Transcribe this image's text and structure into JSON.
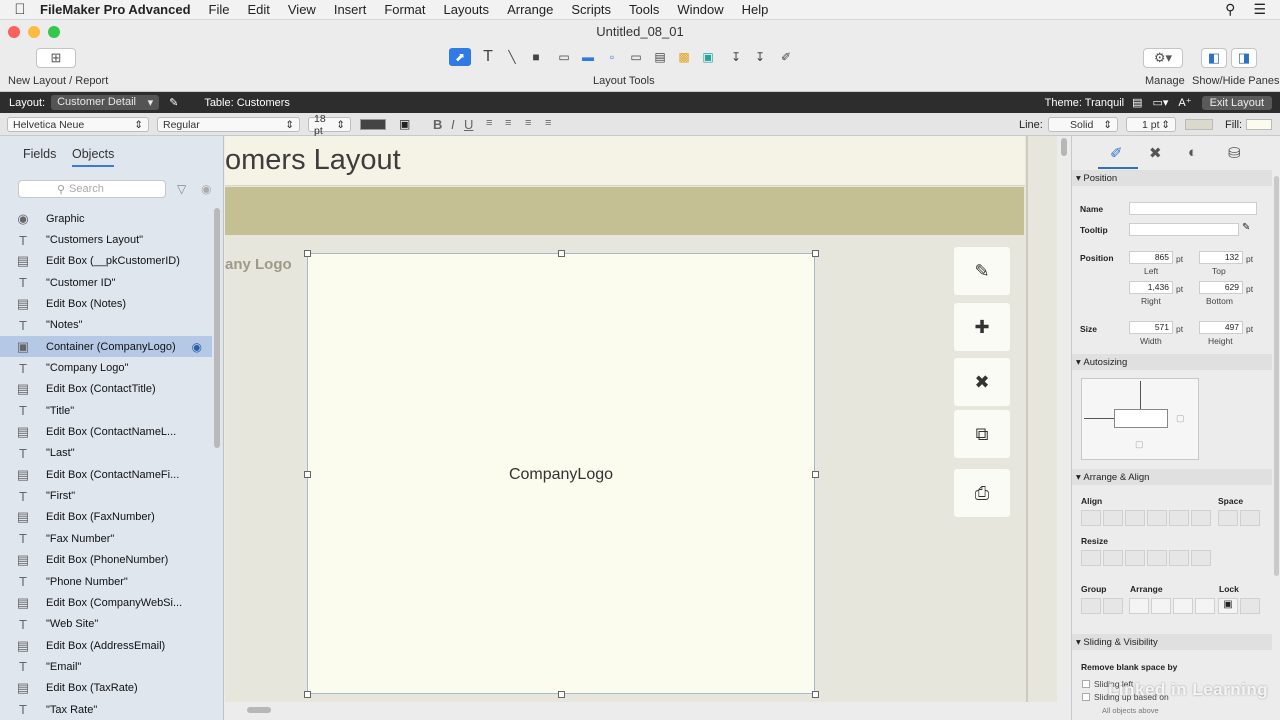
{
  "menubar": {
    "app_name": "FileMaker Pro Advanced",
    "menus": [
      "File",
      "Edit",
      "View",
      "Insert",
      "Format",
      "Layouts",
      "Arrange",
      "Scripts",
      "Tools",
      "Window",
      "Help"
    ]
  },
  "window": {
    "title": "Untitled_08_01"
  },
  "toolbar": {
    "new_layout_label": "New Layout / Report",
    "layout_tools_label": "Layout Tools",
    "manage_label": "Manage",
    "show_hide_label": "Show/Hide Panes"
  },
  "layoutbar": {
    "layout_label": "Layout:",
    "layout_value": "Customer Detail",
    "table_label": "Table: Customers",
    "theme_label": "Theme: Tranquil",
    "exit_label": "Exit Layout"
  },
  "formatbar": {
    "font": "Helvetica Neue",
    "style": "Regular",
    "size": "18 pt",
    "line_label": "Line:",
    "line_style": "Solid",
    "line_width": "1 pt",
    "fill_label": "Fill:"
  },
  "leftpane": {
    "tab_fields": "Fields",
    "tab_objects": "Objects",
    "search_placeholder": "Search",
    "objects": [
      {
        "icon": "camera-icon",
        "label": "Graphic"
      },
      {
        "icon": "text-icon",
        "label": "\"Customers Layout\""
      },
      {
        "icon": "editbox-icon",
        "label": "Edit Box (__pkCustomerID)"
      },
      {
        "icon": "text-icon",
        "label": "\"Customer ID\""
      },
      {
        "icon": "editbox-icon",
        "label": "Edit Box (Notes)"
      },
      {
        "icon": "text-icon",
        "label": "\"Notes\""
      },
      {
        "icon": "container-icon",
        "label": "Container (CompanyLogo)"
      },
      {
        "icon": "text-icon",
        "label": "\"Company Logo\""
      },
      {
        "icon": "editbox-icon",
        "label": "Edit Box (ContactTitle)"
      },
      {
        "icon": "text-icon",
        "label": "\"Title\""
      },
      {
        "icon": "editbox-icon",
        "label": "Edit Box (ContactNameL..."
      },
      {
        "icon": "text-icon",
        "label": "\"Last\""
      },
      {
        "icon": "editbox-icon",
        "label": "Edit Box (ContactNameFi..."
      },
      {
        "icon": "text-icon",
        "label": "\"First\""
      },
      {
        "icon": "editbox-icon",
        "label": "Edit Box (FaxNumber)"
      },
      {
        "icon": "text-icon",
        "label": "\"Fax Number\""
      },
      {
        "icon": "editbox-icon",
        "label": "Edit Box (PhoneNumber)"
      },
      {
        "icon": "text-icon",
        "label": "\"Phone Number\""
      },
      {
        "icon": "editbox-icon",
        "label": "Edit Box (CompanyWebSi..."
      },
      {
        "icon": "text-icon",
        "label": "\"Web Site\""
      },
      {
        "icon": "editbox-icon",
        "label": "Edit Box (AddressEmail)"
      },
      {
        "icon": "text-icon",
        "label": "\"Email\""
      },
      {
        "icon": "editbox-icon",
        "label": "Edit Box (TaxRate)"
      },
      {
        "icon": "text-icon",
        "label": "\"Tax Rate\""
      }
    ]
  },
  "canvas": {
    "layout_title": "omers Layout",
    "logo_label": "any Logo",
    "container_text": "CompanyLogo"
  },
  "inspector": {
    "position_section": "Position",
    "name_label": "Name",
    "tooltip_label": "Tooltip",
    "position_label": "Position",
    "left_value": "865",
    "top_value": "132",
    "right_value": "1,436",
    "bottom_value": "629",
    "left_label": "Left",
    "top_label": "Top",
    "right_label": "Right",
    "bottom_label": "Bottom",
    "size_label": "Size",
    "width_value": "571",
    "height_value": "497",
    "width_label": "Width",
    "height_label": "Height",
    "unit": "pt",
    "autosizing_section": "Autosizing",
    "arrange_section": "Arrange & Align",
    "align_label": "Align",
    "space_label": "Space",
    "resize_label": "Resize",
    "group_label": "Group",
    "arrange_label": "Arrange",
    "lock_label": "Lock",
    "sliding_section": "Sliding & Visibility",
    "remove_blank_label": "Remove blank space by",
    "sliding_left": "Sliding left",
    "sliding_up": "Sliding up based on",
    "all_objects_above": "All objects above"
  },
  "watermark": "Linked in Learning"
}
